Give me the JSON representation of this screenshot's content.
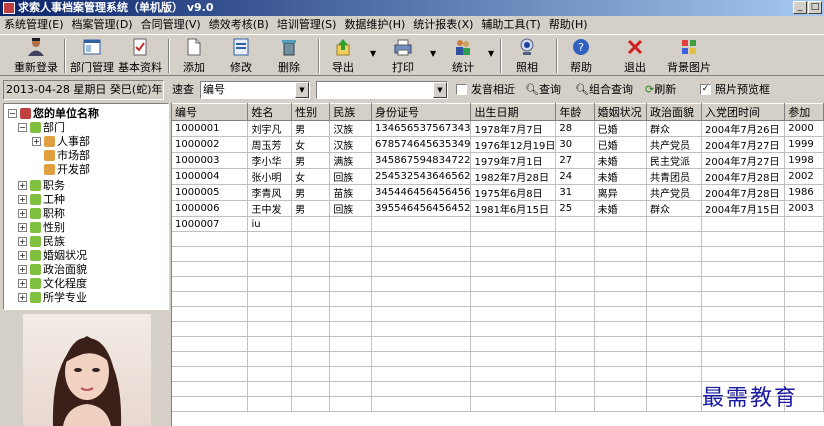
{
  "window": {
    "title": "求索人事档案管理系统（单机版） v9.0",
    "controls": [
      "_",
      "□"
    ]
  },
  "menu": [
    "系统管理(E)",
    "档案管理(D)",
    "合同管理(V)",
    "绩效考核(B)",
    "培训管理(S)",
    "数据维护(H)",
    "统计报表(X)",
    "辅助工具(T)",
    "帮助(H)"
  ],
  "toolbar": {
    "relogin": "重新登录",
    "dept": "部门管理",
    "basic": "基本资料",
    "add": "添加",
    "edit": "修改",
    "delete": "删除",
    "export": "导出",
    "print": "打印",
    "stats": "统计",
    "photo": "照相",
    "help": "帮助",
    "exit": "退出",
    "bgimg": "背景图片"
  },
  "filter": {
    "date": "2013-04-28 星期日 癸巳(蛇)年",
    "quick_label": "速查",
    "field_value": "编号",
    "search_value": "",
    "fuzzy_label": "发音相近",
    "query_label": "查询",
    "combo_query_label": "组合查询",
    "refresh_label": "刷新",
    "photo_preview_label": "照片预览框",
    "photo_preview_checked": "✓"
  },
  "tree": {
    "root": "您的单位名称",
    "dept": "部门",
    "depts": [
      "人事部",
      "市场部",
      "开发部"
    ],
    "categories": [
      "职务",
      "工种",
      "职称",
      "性别",
      "民族",
      "婚姻状况",
      "政治面貌",
      "文化程度",
      "所学专业"
    ]
  },
  "table": {
    "columns": [
      "编号",
      "姓名",
      "性别",
      "民族",
      "身份证号",
      "出生日期",
      "年龄",
      "婚姻状况",
      "政治面貌",
      "入党团时间",
      "参加"
    ],
    "rows": [
      [
        "1000001",
        "刘宇凡",
        "男",
        "汉族",
        "134656537567343",
        "1978年7月7日",
        "28",
        "已婚",
        "群众",
        "2004年7月26日",
        "2000"
      ],
      [
        "1000002",
        "周玉芳",
        "女",
        "汉族",
        "678574645635349",
        "1976年12月19日",
        "30",
        "已婚",
        "共产党员",
        "2004年7月27日",
        "1999"
      ],
      [
        "1000003",
        "李小华",
        "男",
        "满族",
        "345867594834722",
        "1979年7月1日",
        "27",
        "未婚",
        "民主党派",
        "2004年7月27日",
        "1998"
      ],
      [
        "1000004",
        "张小明",
        "女",
        "回族",
        "254532543646562",
        "1982年7月28日",
        "24",
        "未婚",
        "共青团员",
        "2004年7月28日",
        "2002"
      ],
      [
        "1000005",
        "李青风",
        "男",
        "苗族",
        "345446456456456",
        "1975年6月8日",
        "31",
        "离异",
        "共产党员",
        "2004年7月28日",
        "1986"
      ],
      [
        "1000006",
        "王中发",
        "男",
        "回族",
        "395546456456452",
        "1981年6月15日",
        "25",
        "未婚",
        "群众",
        "2004年7月15日",
        "2003"
      ],
      [
        "1000007",
        "iu",
        "",
        "",
        "",
        "",
        "",
        "",
        "",
        "",
        ""
      ]
    ],
    "empty_rows": 12
  },
  "watermark": "最需教育"
}
